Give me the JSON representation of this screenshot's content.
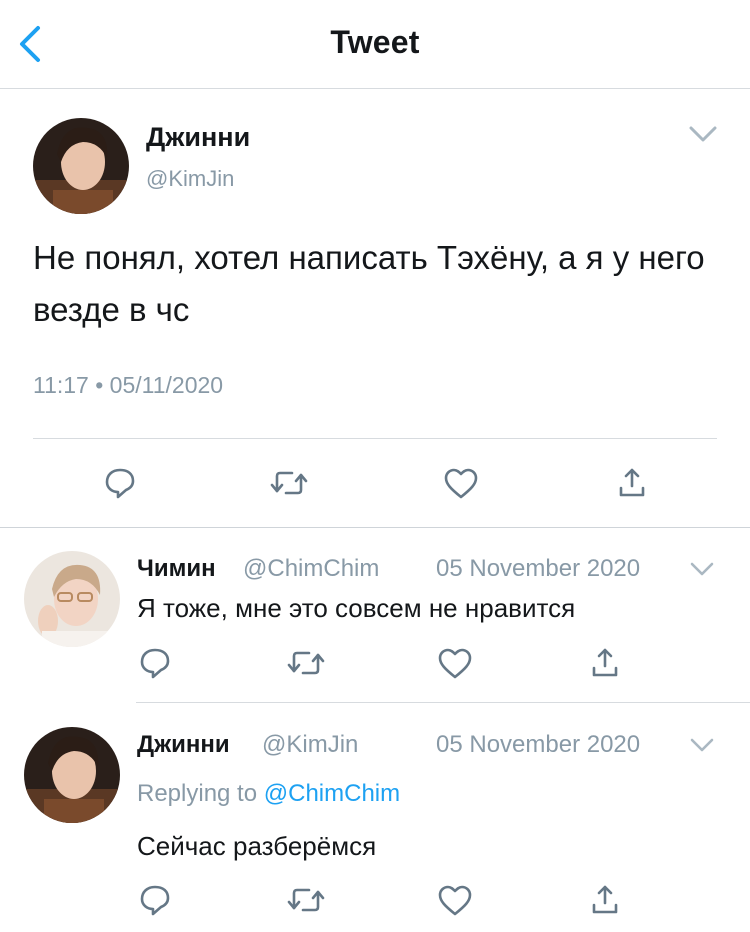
{
  "header": {
    "title": "Tweet"
  },
  "main_tweet": {
    "name": "Джинни",
    "handle": "@KimJin",
    "text": "Не понял, хотел написать Тэхёну, а я у него везде в чс",
    "timestamp": "11:17 • 05/11/2020"
  },
  "replies": [
    {
      "name": "Чимин",
      "handle": "@ChimChim",
      "date": "05 November 2020",
      "text": "Я тоже, мне это совсем не нравится"
    },
    {
      "name": "Джинни",
      "handle": "@KimJin",
      "date": "05 November 2020",
      "replying_to_label": "Replying to",
      "replying_to_handle": "@ChimChim",
      "text": "Сейчас разберёмся"
    }
  ],
  "icons": {
    "back": "chevron-left-icon",
    "more": "chevron-down-icon",
    "reply": "reply-icon",
    "retweet": "retweet-icon",
    "like": "heart-icon",
    "share": "share-icon"
  },
  "colors": {
    "accent": "#1da1f2",
    "text": "#14171a",
    "muted": "#8899a6",
    "divider": "#d7dbdf"
  }
}
